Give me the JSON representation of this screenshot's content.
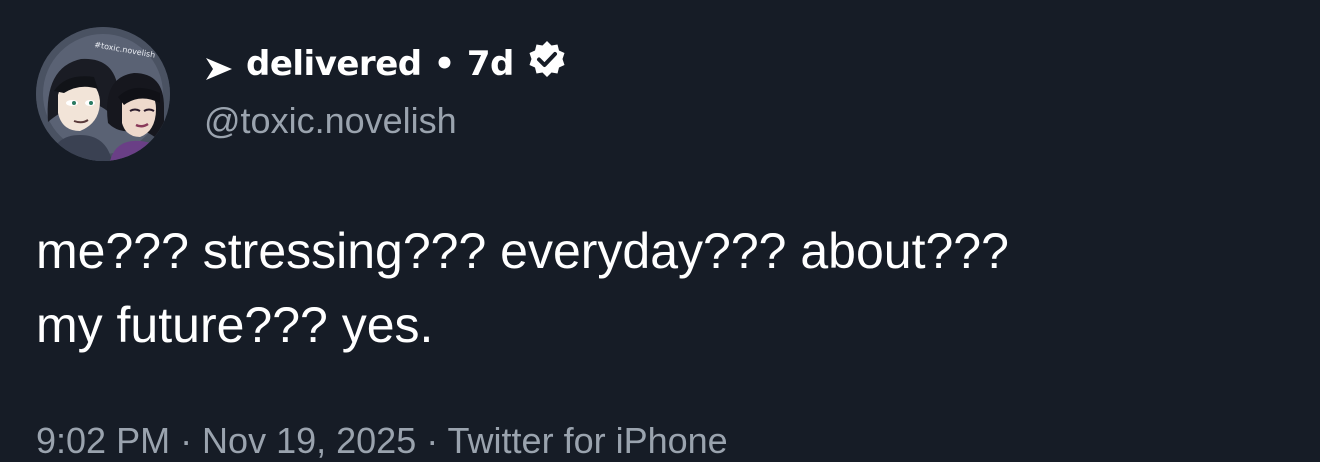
{
  "tweet": {
    "display_name": "delivered",
    "separator": "•",
    "age": "7d",
    "handle": "@toxic.novelish",
    "text_lines": [
      "me??? stressing??? everyday??? about???",
      "my future??? yes."
    ],
    "meta": "9:02 PM · Nov 19, 2025 · Twitter for iPhone",
    "avatar_watermark": "#toxic.novelish"
  },
  "icons": {
    "name_prefix": "arrow-right-icon",
    "badge": "verified-badge-icon"
  },
  "colors": {
    "background": "#161c26",
    "primary_text": "#ffffff",
    "secondary_text": "#9aa3ae"
  }
}
